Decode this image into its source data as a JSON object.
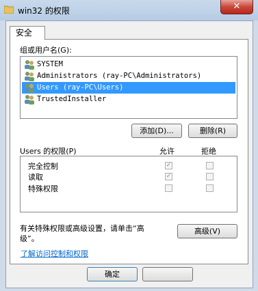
{
  "window": {
    "title": "win32 的权限",
    "close_glyph": "✕"
  },
  "tab": {
    "label": "安全"
  },
  "groups_label": "组或用户名(G):",
  "users": [
    {
      "name": "SYSTEM",
      "selected": false
    },
    {
      "name": "Administrators (ray-PC\\Administrators)",
      "selected": false
    },
    {
      "name": "Users (ray-PC\\Users)",
      "selected": true
    },
    {
      "name": "TrustedInstaller",
      "selected": false
    }
  ],
  "buttons": {
    "add": "添加(D)...",
    "remove": "删除(R)",
    "advanced": "高级(V)",
    "ok": "确定"
  },
  "permissions": {
    "header": "Users 的权限(P)",
    "allow_header": "允许",
    "deny_header": "拒绝",
    "rows": [
      {
        "label": "完全控制",
        "allow": true,
        "deny": false
      },
      {
        "label": "读取",
        "allow": true,
        "deny": false
      },
      {
        "label": "特殊权限",
        "allow": false,
        "deny": false
      }
    ]
  },
  "advanced_text_line1": "有关特殊权限或高级设置，请单击“高",
  "advanced_text_line2": "级”。",
  "help_link": "了解访问控制和权限",
  "colors": {
    "selection": "#3399ff",
    "link": "#0066cc",
    "close": "#c9493b"
  }
}
